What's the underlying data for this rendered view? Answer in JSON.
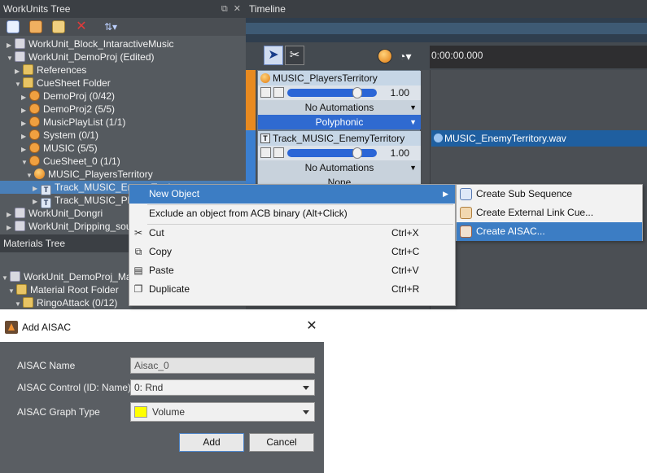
{
  "workunits": {
    "title": "WorkUnits Tree",
    "title_buttons": "⧉ ✕",
    "items": [
      {
        "label": "WorkUnit_Block_IntaractiveMusic"
      },
      {
        "label": "WorkUnit_DemoProj (Edited)"
      },
      {
        "label": "References"
      },
      {
        "label": "CueSheet Folder"
      },
      {
        "label": "DemoProj (0/42)"
      },
      {
        "label": "DemoProj2 (5/5)"
      },
      {
        "label": "MusicPlayList (1/1)"
      },
      {
        "label": "System (0/1)"
      },
      {
        "label": "MUSIC (5/5)"
      },
      {
        "label": "CueSheet_0 (1/1)"
      },
      {
        "label": "MUSIC_PlayersTerritory"
      },
      {
        "label": "Track_MUSIC_EnemyTerritory"
      },
      {
        "label": "Track_MUSIC_PlayersTerritory"
      },
      {
        "label": "WorkUnit_Dongri"
      },
      {
        "label": "WorkUnit_Dripping_sound"
      }
    ]
  },
  "materials": {
    "title": "Materials Tree",
    "items": [
      {
        "label": "WorkUnit_DemoProj_Materials"
      },
      {
        "label": "Material Root Folder"
      },
      {
        "label": "RingoAttack (0/12)"
      }
    ]
  },
  "timeline": {
    "title": "Timeline",
    "time": "0:00:00.000",
    "tracks": [
      {
        "name": "MUSIC_PlayersTerritory",
        "volume": "1.00",
        "volume_level": 0.82,
        "automation": "No Automations",
        "mode": "Polyphonic"
      },
      {
        "name": "Track_MUSIC_EnemyTerritory",
        "volume": "1.00",
        "volume_level": 0.82,
        "automation": "No Automations",
        "mode": "None"
      }
    ],
    "clip": "MUSIC_EnemyTerritory.wav"
  },
  "context_menu": {
    "items": [
      {
        "label": "New Object",
        "shortcut": ""
      },
      {
        "label": "Exclude an object from ACB binary (Alt+Click)",
        "shortcut": ""
      },
      {
        "label": "Cut",
        "shortcut": "Ctrl+X"
      },
      {
        "label": "Copy",
        "shortcut": "Ctrl+C"
      },
      {
        "label": "Paste",
        "shortcut": "Ctrl+V"
      },
      {
        "label": "Duplicate",
        "shortcut": "Ctrl+R"
      }
    ],
    "submenu": [
      {
        "label": "Create Sub Sequence"
      },
      {
        "label": "Create External Link Cue..."
      },
      {
        "label": "Create AISAC..."
      }
    ]
  },
  "dialog": {
    "title": "Add AISAC",
    "close": "✕",
    "name_label": "AISAC Name",
    "name_value": "Aisac_0",
    "control_label": "AISAC Control (ID: Name)",
    "control_value": "0: Rnd",
    "graph_label": "AISAC Graph Type",
    "graph_value": "Volume",
    "graph_color": "#ffff00",
    "add_label": "Add",
    "cancel_label": "Cancel"
  }
}
